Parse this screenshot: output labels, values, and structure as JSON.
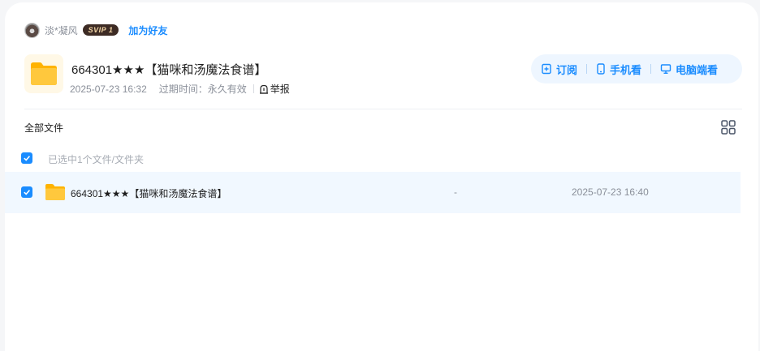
{
  "sharer": {
    "name": "淡*凝风",
    "vip_badge": "SVIP 1",
    "add_friend": "加为好友"
  },
  "share": {
    "title": "664301★★★【猫咪和汤魔法食谱】",
    "created": "2025-07-23 16:32",
    "expiry_label": "过期时间：永久有效",
    "report": "举报"
  },
  "actions": [
    {
      "label": "订阅",
      "icon": "subscribe-icon"
    },
    {
      "label": "手机看",
      "icon": "phone-icon"
    },
    {
      "label": "电脑端看",
      "icon": "monitor-icon"
    }
  ],
  "breadcrumb": "全部文件",
  "selection_text": "已选中1个文件/文件夹",
  "files": [
    {
      "name": "664301★★★【猫咪和汤魔法食谱】",
      "size": "-",
      "modified": "2025-07-23 16:40",
      "checked": true,
      "icon": "folder-icon"
    }
  ],
  "colors": {
    "accent": "#1a8cff",
    "folder": "#ffc83d",
    "row_selected": "#f1f8ff",
    "action_bg": "#eef6ff"
  }
}
